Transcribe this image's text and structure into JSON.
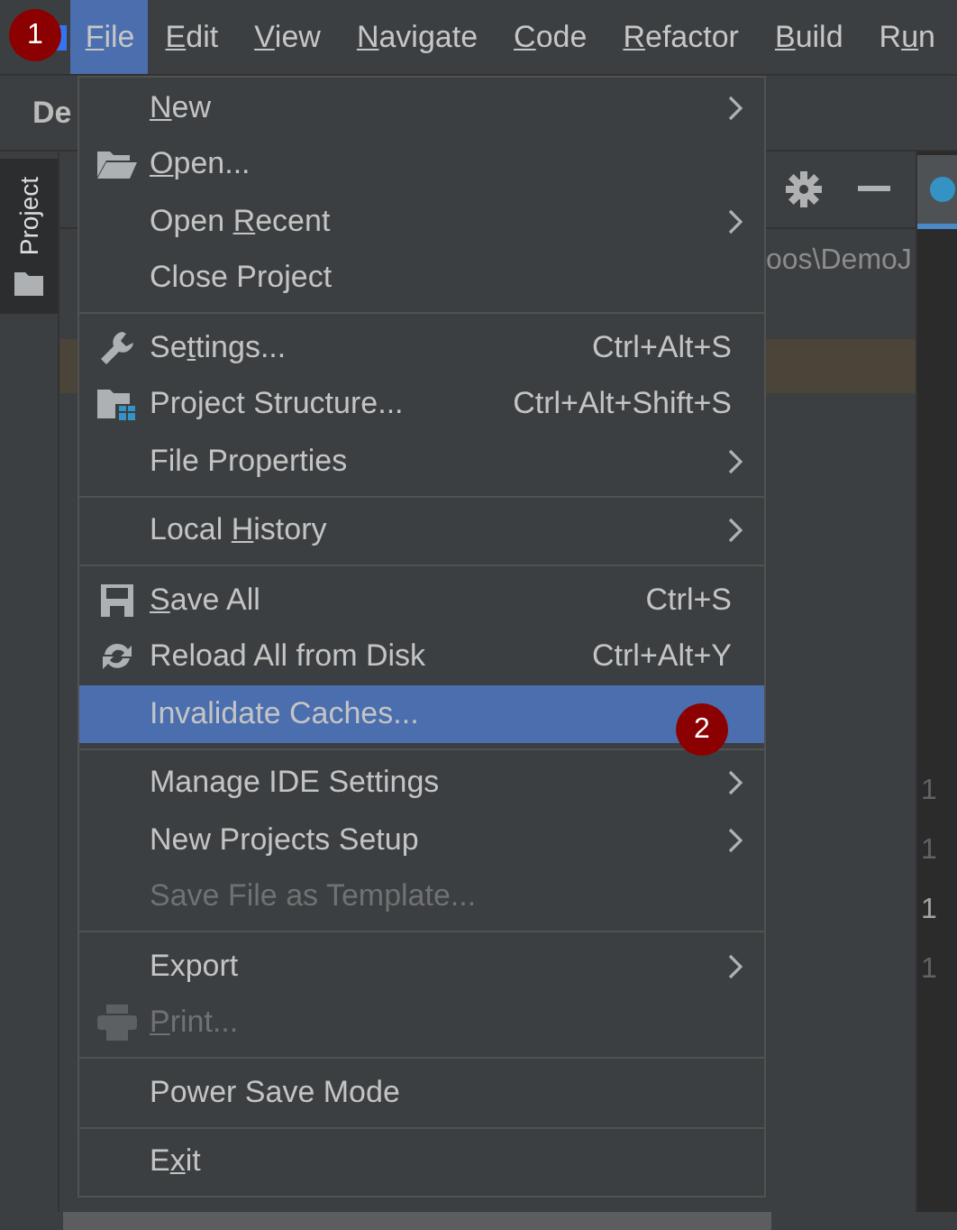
{
  "menubar": [
    {
      "label": "File",
      "selected": true
    },
    {
      "label": "Edit",
      "selected": false
    },
    {
      "label": "View",
      "selected": false
    },
    {
      "label": "Navigate",
      "selected": false
    },
    {
      "label": "Code",
      "selected": false
    },
    {
      "label": "Refactor",
      "selected": false
    },
    {
      "label": "Build",
      "selected": false
    },
    {
      "label": "Run",
      "selected": false
    }
  ],
  "navigation_bar": {
    "project": "De"
  },
  "tool_window": {
    "tab": "Project",
    "path": "oos\\DemoJ"
  },
  "editor": {
    "line_numbers": [
      {
        "text": "1",
        "current": false
      },
      {
        "text": "1",
        "current": false
      },
      {
        "text": "1",
        "current": true
      },
      {
        "text": "1",
        "current": false
      }
    ]
  },
  "file_menu": {
    "groups": [
      [
        {
          "label": "New",
          "submenu": true,
          "disabled": false,
          "selected": false
        },
        {
          "label": "Open...",
          "submenu": false,
          "disabled": false,
          "selected": false
        },
        {
          "label": "Open Recent",
          "submenu": true,
          "disabled": false,
          "selected": false
        },
        {
          "label": "Close Project",
          "submenu": false,
          "disabled": false,
          "selected": false
        }
      ],
      [
        {
          "label": "Settings...",
          "shortcut": "Ctrl+Alt+S",
          "submenu": false,
          "disabled": false,
          "selected": false
        },
        {
          "label": "Project Structure...",
          "shortcut": "Ctrl+Alt+Shift+S",
          "submenu": false,
          "disabled": false,
          "selected": false
        },
        {
          "label": "File Properties",
          "submenu": true,
          "disabled": false,
          "selected": false
        }
      ],
      [
        {
          "label": "Local History",
          "submenu": true,
          "disabled": false,
          "selected": false
        }
      ],
      [
        {
          "label": "Save All",
          "shortcut": "Ctrl+S",
          "submenu": false,
          "disabled": false,
          "selected": false
        },
        {
          "label": "Reload All from Disk",
          "shortcut": "Ctrl+Alt+Y",
          "submenu": false,
          "disabled": false,
          "selected": false
        },
        {
          "label": "Invalidate Caches...",
          "submenu": false,
          "disabled": false,
          "selected": true
        }
      ],
      [
        {
          "label": "Manage IDE Settings",
          "submenu": true,
          "disabled": false,
          "selected": false
        },
        {
          "label": "New Projects Setup",
          "submenu": true,
          "disabled": false,
          "selected": false
        },
        {
          "label": "Save File as Template...",
          "submenu": false,
          "disabled": true,
          "selected": false
        }
      ],
      [
        {
          "label": "Export",
          "submenu": true,
          "disabled": false,
          "selected": false
        },
        {
          "label": "Print...",
          "submenu": false,
          "disabled": true,
          "selected": false
        }
      ],
      [
        {
          "label": "Power Save Mode",
          "submenu": false,
          "disabled": false,
          "selected": false
        }
      ],
      [
        {
          "label": "Exit",
          "submenu": false,
          "disabled": false,
          "selected": false
        }
      ]
    ]
  },
  "markers": [
    {
      "label": "1"
    },
    {
      "label": "2"
    }
  ]
}
